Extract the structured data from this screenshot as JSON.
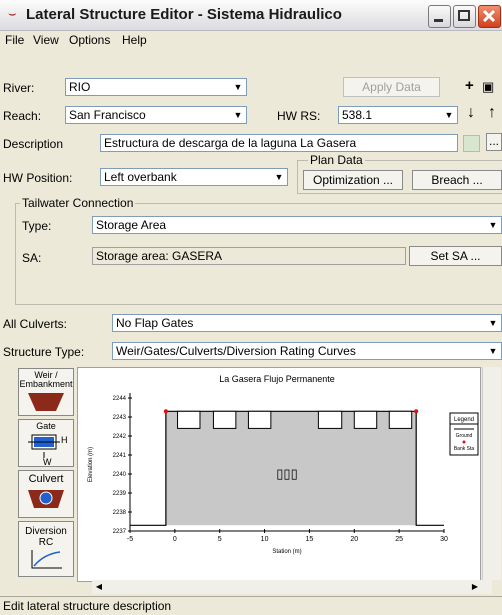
{
  "window": {
    "title": "Lateral Structure Editor - Sistema Hidraulico",
    "app_icon": "hec-ras-wave-icon"
  },
  "menu": [
    "File",
    "View",
    "Options",
    "Help"
  ],
  "river": {
    "label": "River:",
    "value": "RIO"
  },
  "apply_data_label": "Apply Data",
  "reach": {
    "label": "Reach:",
    "value": "San Francisco"
  },
  "hw_rs": {
    "label": "HW RS:",
    "value": "538.1"
  },
  "description": {
    "label": "Description",
    "value": "Estructura de descarga de la laguna La Gasera"
  },
  "hw_position": {
    "label": "HW Position:",
    "value": "Left overbank"
  },
  "plan_data": {
    "title": "Plan Data",
    "optimization_label": "Optimization ...",
    "breach_label": "Breach ..."
  },
  "tailwater": {
    "title": "Tailwater Connection",
    "type_label": "Type:",
    "type_value": "Storage Area",
    "sa_label": "SA:",
    "sa_value": "Storage area: GASERA",
    "set_sa_label": "Set SA ..."
  },
  "all_culverts": {
    "label": "All Culverts:",
    "value": "No Flap Gates"
  },
  "structure_type": {
    "label": "Structure Type:",
    "value": "Weir/Gates/Culverts/Diversion Rating Curves"
  },
  "side_buttons": {
    "weir": "Weir / Embankment",
    "gate": "Gate",
    "gate_h": "H",
    "gate_w": "W",
    "culvert": "Culvert",
    "diversion": "Diversion RC"
  },
  "chart_data": {
    "type": "line",
    "title": "La Gasera Flujo Permanente",
    "xlabel": "Station (m)",
    "ylabel": "Elevation (m)",
    "xlim": [
      -5,
      30
    ],
    "ylim": [
      2237,
      2244
    ],
    "x_ticks": [
      "-5",
      "0",
      "5",
      "10",
      "15",
      "20",
      "25",
      "30"
    ],
    "y_ticks": [
      "2237",
      "2238",
      "2239",
      "2240",
      "2241",
      "2242",
      "2243",
      "2244"
    ],
    "legend": {
      "title": "Legend",
      "entries": [
        "Ground",
        "Bank Sta"
      ]
    },
    "ground": [
      [
        -5,
        2237.3
      ],
      [
        -1,
        2237.3
      ],
      [
        -1,
        2243.3
      ],
      [
        26.9,
        2243.3
      ],
      [
        26.9,
        2237.3
      ],
      [
        30,
        2237.3
      ]
    ],
    "bank_stations": [
      [
        -1,
        2243.3
      ],
      [
        26.9,
        2243.3
      ]
    ],
    "gates_left": [
      [
        0.3,
        2.8
      ],
      [
        4.3,
        6.8
      ],
      [
        8.2,
        10.7
      ]
    ],
    "gates_right": [
      [
        16,
        18.6
      ],
      [
        20,
        22.5
      ],
      [
        23.9,
        26.4
      ]
    ],
    "gate_bottom": 2242.4,
    "culvert_label": "ooo"
  },
  "status_text": "Edit lateral structure description"
}
